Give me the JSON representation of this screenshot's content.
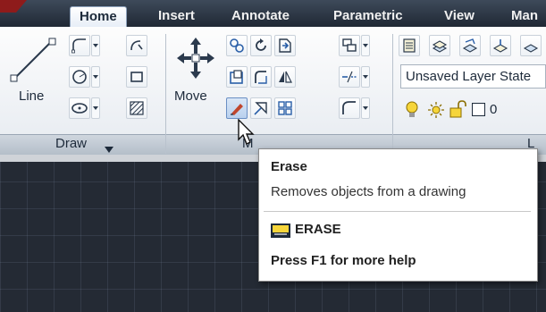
{
  "tabs": [
    {
      "label": "Home"
    },
    {
      "label": "Insert"
    },
    {
      "label": "Annotate"
    },
    {
      "label": "Parametric"
    },
    {
      "label": "View"
    },
    {
      "label": "Man"
    }
  ],
  "draw_panel": {
    "line_label": "Line",
    "title": "Draw"
  },
  "modify_panel": {
    "move_label": "Move",
    "title": "M"
  },
  "layers_panel": {
    "layer_state": "Unsaved Layer State",
    "layer_name": "0",
    "title": "L"
  },
  "tooltip": {
    "title": "Erase",
    "description": "Removes objects from a drawing",
    "command": "ERASE",
    "help": "Press F1 for more help"
  },
  "colors": {
    "accent": "#1f2733",
    "tooltip_bg": "#ffffff",
    "canvas": "#242a34"
  }
}
